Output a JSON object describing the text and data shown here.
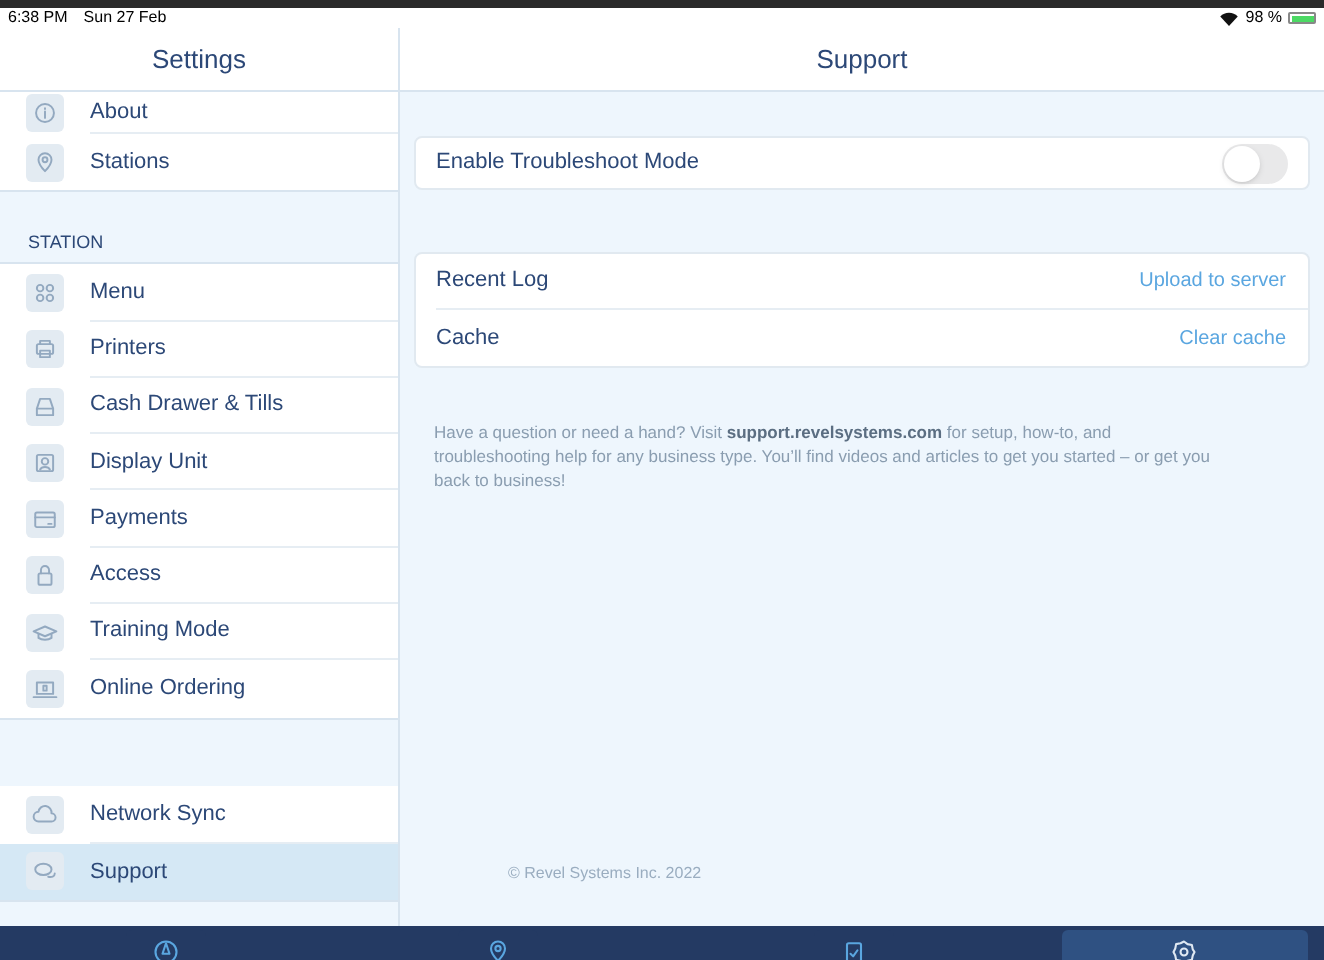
{
  "status_bar": {
    "time": "6:38 PM",
    "date": "Sun 27 Feb",
    "battery_text": "98 %"
  },
  "sidebar": {
    "title": "Settings",
    "groups": [
      {
        "items": [
          {
            "label": "About",
            "selected": false
          },
          {
            "label": "Stations",
            "selected": false
          }
        ]
      },
      {
        "header": "STATION",
        "items": [
          {
            "label": "Menu",
            "selected": false
          },
          {
            "label": "Printers",
            "selected": false
          },
          {
            "label": "Cash Drawer & Tills",
            "selected": false
          },
          {
            "label": "Display Unit",
            "selected": false
          },
          {
            "label": "Payments",
            "selected": false
          },
          {
            "label": "Access",
            "selected": false
          },
          {
            "label": "Training Mode",
            "selected": false
          },
          {
            "label": "Online Ordering",
            "selected": false
          }
        ]
      },
      {
        "items": [
          {
            "label": "Network Sync",
            "selected": false
          },
          {
            "label": "Support",
            "selected": true
          }
        ]
      }
    ]
  },
  "detail": {
    "title": "Support",
    "toggle": {
      "label": "Enable Troubleshoot Mode",
      "on": false
    },
    "rows": [
      {
        "label": "Recent Log",
        "action": "Upload to server"
      },
      {
        "label": "Cache",
        "action": "Clear cache"
      }
    ],
    "help_text": "Have a question or need a hand? Visit **support.revelsystems.com** for setup, how-to, and troubleshooting help for any business type. You’ll find videos and articles to get you started – or get you back to business!",
    "footer": "© Revel Systems Inc. 2022"
  },
  "tab_bar": [
    {
      "selected": false
    },
    {
      "selected": false
    },
    {
      "selected": false
    },
    {
      "selected": true
    }
  ]
}
